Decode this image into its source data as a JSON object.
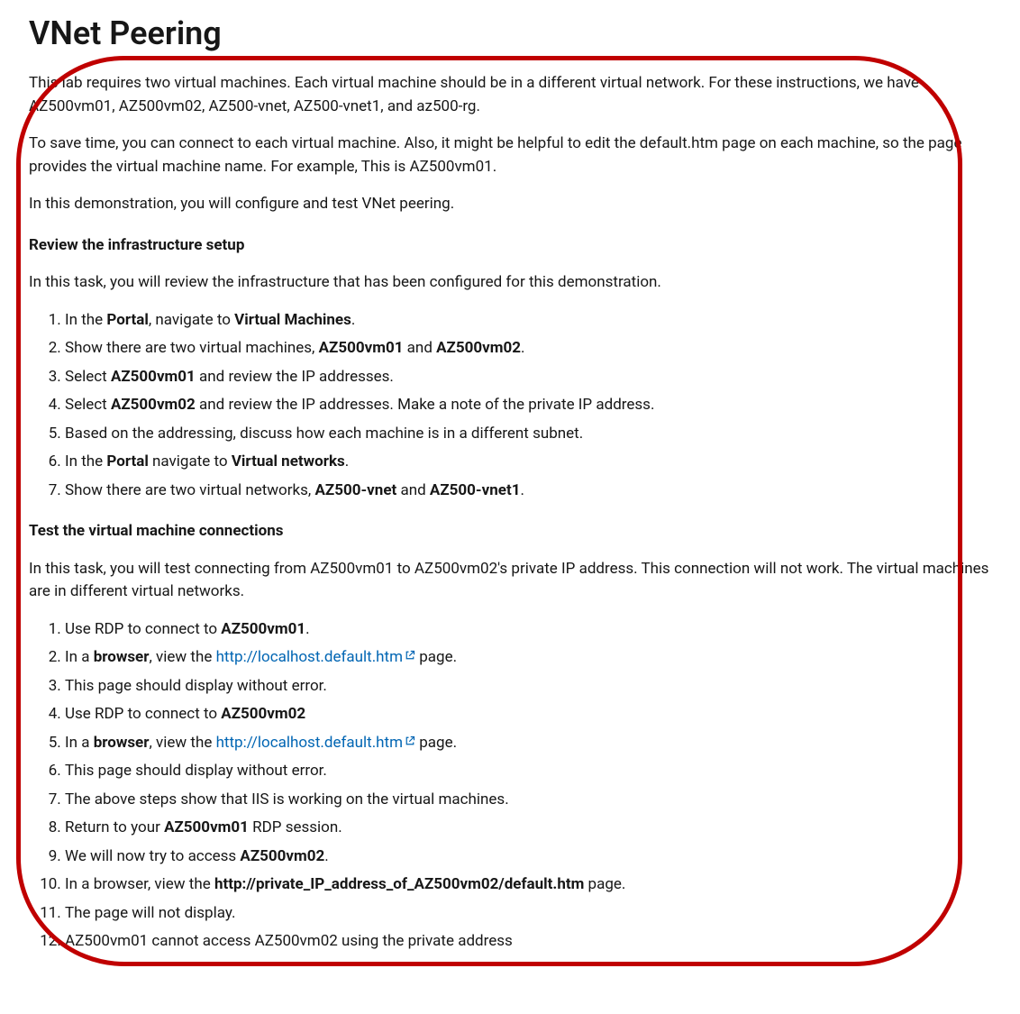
{
  "title": "VNet Peering",
  "intro1": "This lab requires two virtual machines. Each virtual machine should be in a different virtual network. For these instructions, we have AZ500vm01, AZ500vm02, AZ500-vnet, AZ500-vnet1, and az500-rg.",
  "intro2": "To save time, you can connect to each virtual machine. Also, it might be helpful to edit the default.htm page on each machine, so the page provides the virtual machine name. For example, This is AZ500vm01.",
  "intro3": "In this demonstration, you will configure and test VNet peering.",
  "section1": {
    "heading": "Review the infrastructure setup",
    "lead": "In this task, you will review the infrastructure that has been configured for this demonstration.",
    "items": [
      {
        "pre": "In the ",
        "b1": "Portal",
        "mid": ", navigate to ",
        "b2": "Virtual Machines",
        "post": "."
      },
      {
        "pre": "Show there are two virtual machines, ",
        "b1": "AZ500vm01",
        "mid": " and ",
        "b2": "AZ500vm02",
        "post": "."
      },
      {
        "pre": "Select ",
        "b1": "AZ500vm01",
        "post": " and review the IP addresses."
      },
      {
        "pre": "Select ",
        "b1": "AZ500vm02",
        "post": " and review the IP addresses. Make a note of the private IP address."
      },
      {
        "plain": "Based on the addressing, discuss how each machine is in a different subnet."
      },
      {
        "pre": "In the ",
        "b1": "Portal",
        "mid": " navigate to ",
        "b2": "Virtual networks",
        "post": "."
      },
      {
        "pre": "Show there are two virtual networks, ",
        "b1": "AZ500-vnet",
        "mid": " and ",
        "b2": "AZ500-vnet1",
        "post": "."
      }
    ]
  },
  "section2": {
    "heading": "Test the virtual machine connections",
    "lead": "In this task, you will test connecting from AZ500vm01 to AZ500vm02's private IP address. This connection will not work. The virtual machines are in different virtual networks.",
    "items": [
      {
        "pre": "Use RDP to connect to ",
        "b1": "AZ500vm01",
        "post": "."
      },
      {
        "pre": "In a ",
        "b1": "browser",
        "mid": ", view the ",
        "link": "http://localhost.default.htm",
        "post": " page."
      },
      {
        "plain": "This page should display without error."
      },
      {
        "pre": "Use RDP to connect to ",
        "b1": "AZ500vm02"
      },
      {
        "pre": "In a ",
        "b1": "browser",
        "mid": ", view the ",
        "link": "http://localhost.default.htm",
        "post": " page."
      },
      {
        "plain": "This page should display without error."
      },
      {
        "plain": "The above steps show that IIS is working on the virtual machines."
      },
      {
        "pre": "Return to your ",
        "b1": "AZ500vm01",
        "post": " RDP session."
      },
      {
        "pre": "We will now try to access ",
        "b1": "AZ500vm02",
        "post": "."
      },
      {
        "pre": "In a browser, view the ",
        "b1": "http://private_IP_address_of_AZ500vm02/default.htm",
        "post": " page."
      },
      {
        "plain": "The page will not display."
      },
      {
        "plain_partial": "AZ500vm01 cannot access AZ500vm02 using the private address"
      }
    ]
  }
}
